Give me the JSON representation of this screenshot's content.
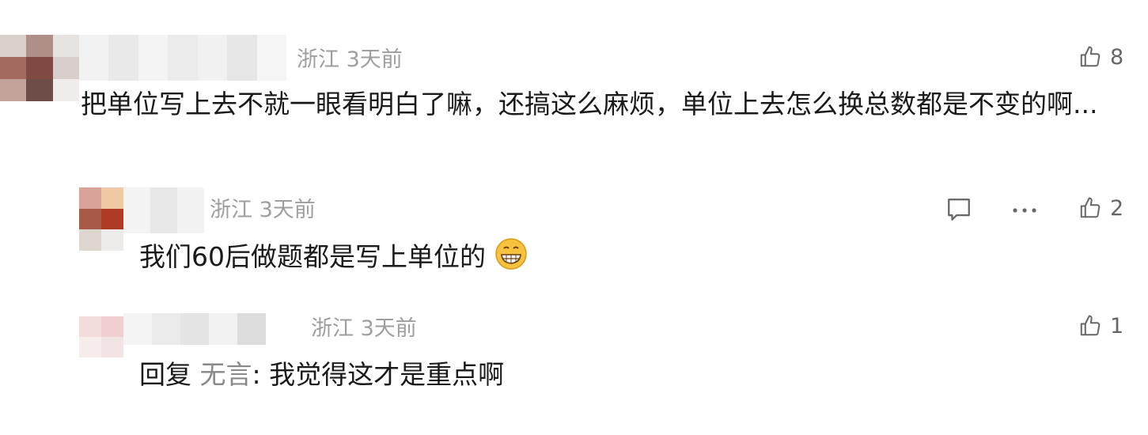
{
  "comments": [
    {
      "location": "浙江",
      "time": "3天前",
      "likes": "8",
      "text": "把单位写上去不就一眼看明白了嘛，还搞这么麻烦，单位上去怎么换总数都是不变的啊..."
    },
    {
      "location": "浙江",
      "time": "3天前",
      "likes": "2",
      "text": "我们60后做题都是写上单位的",
      "emoji": "grinning-face-emoji"
    },
    {
      "location": "浙江",
      "time": "3天前",
      "likes": "1",
      "reply_prefix": "回复",
      "reply_to": "无言",
      "reply_sep": ":",
      "text": "我觉得这才是重点啊"
    }
  ],
  "colors": {
    "meta": "#9e9e9e",
    "text": "#1a1a1a",
    "icon": "#666666"
  }
}
